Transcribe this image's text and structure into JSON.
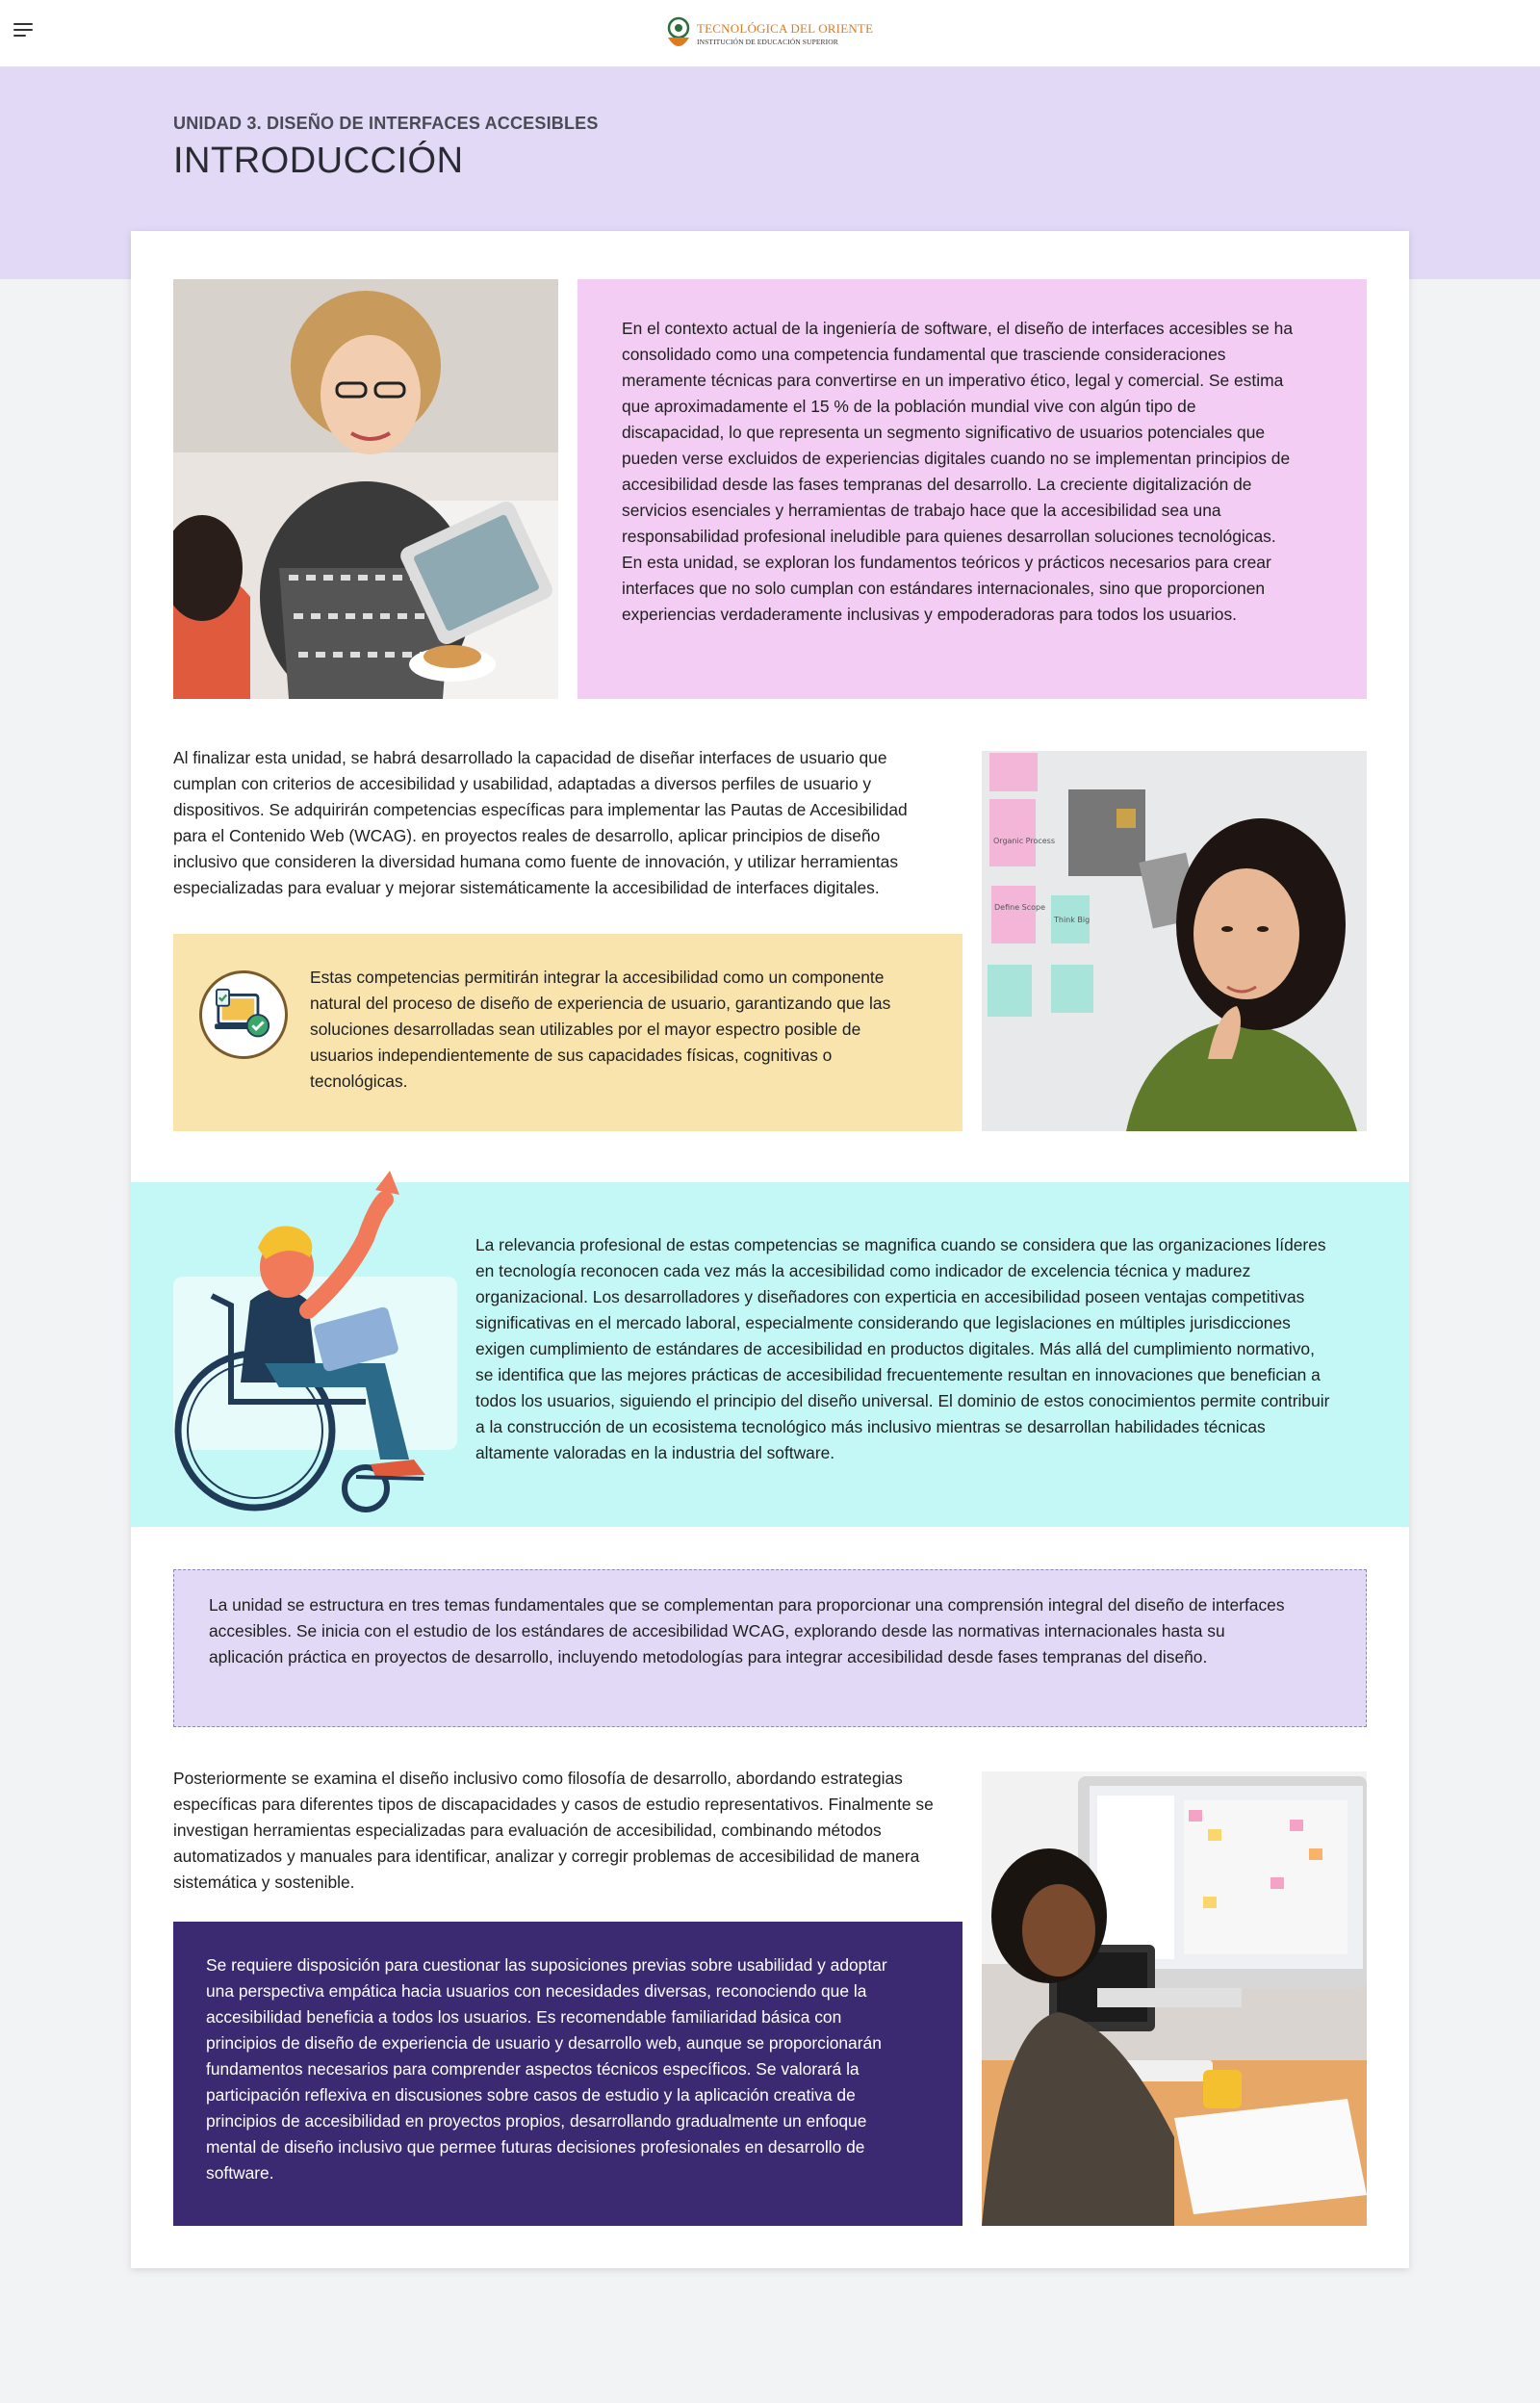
{
  "header": {
    "logo_title": "TECNOLÓGICA DEL ORIENTE",
    "logo_subtitle": "INSTITUCIÓN DE EDUCACIÓN SUPERIOR"
  },
  "hero": {
    "unit": "UNIDAD 3. DISEÑO DE INTERFACES ACCESIBLES",
    "title": "INTRODUCCIÓN"
  },
  "colors": {
    "hero_bg": "#e1d9f6",
    "pink": "#f3cdf3",
    "yellow": "#f9e4ae",
    "cyan": "#c4f8f6",
    "lavender": "#e1d9f6",
    "purple": "#3b2a72",
    "logo_orange": "#e07a1f"
  },
  "icons": [
    "menu-icon",
    "logo-icon",
    "computer-check-icon"
  ],
  "sections": {
    "intro_lines": [
      "En el contexto actual de la ingeniería de software, el diseño de interfaces accesibles se ha",
      "consolidado como una competencia fundamental que trasciende consideraciones",
      "meramente técnicas para convertirse en un imperativo ético, legal y comercial. Se estima",
      "que aproximadamente el 15 % de la población mundial vive con algún tipo de",
      "discapacidad, lo que representa un segmento significativo de usuarios potenciales que",
      "pueden verse excluidos de experiencias digitales cuando no se implementan principios de",
      "accesibilidad desde las fases tempranas del desarrollo. La creciente digitalización de",
      "servicios esenciales y herramientas de trabajo hace que la accesibilidad sea una",
      "responsabilidad profesional ineludible para quienes desarrollan soluciones tecnológicas.",
      "En esta unidad, se exploran los fundamentos teóricos y prácticos necesarios para crear",
      "interfaces que no solo cumplan con estándares internacionales, sino que proporcionen",
      "experiencias verdaderamente inclusivas y empoderadoras para todos los usuarios."
    ],
    "goals_lines": [
      "Al finalizar esta unidad, se habrá desarrollado la capacidad de diseñar interfaces de usuario que",
      "cumplan con criterios de accesibilidad y usabilidad, adaptadas a diversos perfiles de usuario y",
      "dispositivos. Se adquirirán competencias específicas para implementar las Pautas de Accesibilidad",
      "para el Contenido Web (WCAG). en proyectos reales de desarrollo, aplicar principios de diseño",
      "inclusivo que consideren la diversidad humana como fuente de innovación, y utilizar herramientas",
      "especializadas para evaluar y mejorar sistemáticamente la accesibilidad de interfaces digitales."
    ],
    "note_lines": [
      "Estas competencias permitirán integrar la accesibilidad como un componente",
      "natural del proceso de diseño de experiencia de usuario, garantizando que las",
      "soluciones desarrolladas sean utilizables por el mayor espectro posible de",
      "usuarios independientemente de sus capacidades físicas, cognitivas o",
      "tecnológicas."
    ],
    "relevance_lines": [
      "La relevancia profesional de estas competencias se magnifica cuando se considera que las organizaciones líderes",
      "en tecnología reconocen cada vez más la accesibilidad como indicador de excelencia técnica y madurez",
      "organizacional. Los desarrolladores y diseñadores con experticia en accesibilidad poseen ventajas competitivas",
      "significativas en el mercado laboral, especialmente considerando que legislaciones en múltiples jurisdicciones",
      "exigen cumplimiento de estándares de accesibilidad en productos digitales. Más allá del cumplimiento normativo,",
      "se identifica que las mejores prácticas de accesibilidad frecuentemente resultan en innovaciones que benefician a",
      "todos los usuarios, siguiendo el principio del diseño universal. El dominio de estos conocimientos permite contribuir",
      "a la construcción de un ecosistema tecnológico más inclusivo mientras se desarrollan habilidades técnicas",
      "altamente valoradas en la industria del software."
    ],
    "structure_lines": [
      "La unidad se estructura en tres temas fundamentales que se complementan para proporcionar una comprensión integral del diseño de interfaces",
      "accesibles. Se inicia con el estudio de los estándares de accesibilidad WCAG, explorando desde las normativas internacionales hasta su",
      "aplicación práctica en proyectos de desarrollo, incluyendo metodologías para integrar accesibilidad desde fases tempranas del diseño."
    ],
    "followup_lines": [
      "Posteriormente se examina el diseño inclusivo como filosofía de desarrollo, abordando estrategias",
      "específicas para diferentes tipos de discapacidades y casos de estudio representativos. Finalmente se",
      "investigan herramientas especializadas para evaluación de accesibilidad, combinando métodos",
      "automatizados y manuales para identificar, analizar y corregir problemas de accesibilidad de manera",
      "sistemática y sostenible."
    ],
    "requirements_lines": [
      "Se requiere disposición para cuestionar las suposiciones previas sobre usabilidad y adoptar",
      "una perspectiva empática hacia usuarios con necesidades diversas, reconociendo que la",
      "accesibilidad beneficia a todos los usuarios. Es recomendable familiaridad básica con",
      "principios de diseño de experiencia de usuario y desarrollo web, aunque se proporcionarán",
      "fundamentos necesarios para comprender aspectos técnicos específicos. Se valorará la",
      "participación reflexiva en discusiones sobre casos de estudio y la aplicación creativa de",
      "principios de accesibilidad en proyectos propios, desarrollando gradualmente un enfoque",
      "mental de diseño inclusivo que permee futuras decisiones profesionales en desarrollo de",
      "software."
    ]
  },
  "images": {
    "sticky_notes": [
      "Organic Process",
      "Define Scope",
      "Think Big"
    ]
  }
}
